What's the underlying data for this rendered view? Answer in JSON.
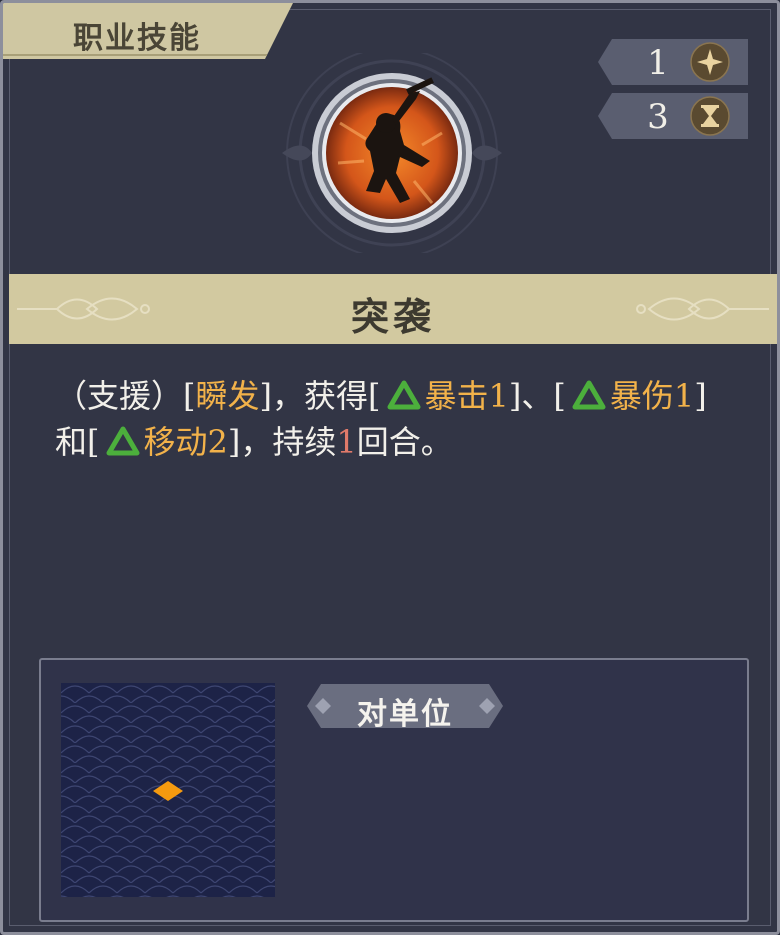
{
  "category": {
    "label": "职业技能"
  },
  "stats": [
    {
      "value": "1",
      "icon": "sparkle-icon"
    },
    {
      "value": "3",
      "icon": "hourglass-icon"
    }
  ],
  "skill": {
    "name": "突袭",
    "icon": "leaping-warrior-icon"
  },
  "description": {
    "p1": "（支援）[",
    "tag_instant": "瞬发",
    "p2": "]，获得[",
    "buff1": "暴击1",
    "p3": "]、[",
    "buff2": "暴伤1",
    "p4": "]和[",
    "buff3": "移动2",
    "p5": "]，持续",
    "duration": "1",
    "p6": "回合。"
  },
  "range": {
    "target_label": "对单位"
  },
  "colors": {
    "highlight": "#f2b24a",
    "number_accent": "#e07a6a",
    "buff_triangle": "#4caf3c",
    "title_band": "#d2c9a0",
    "panel_bg": "#323545"
  }
}
